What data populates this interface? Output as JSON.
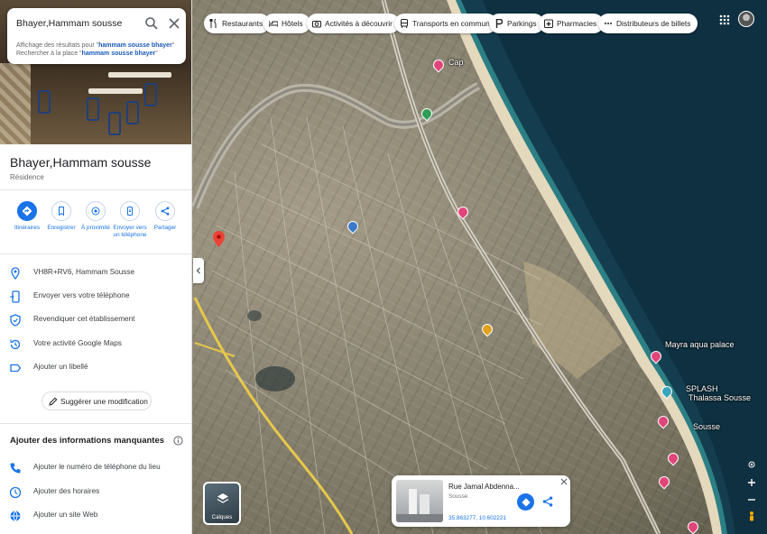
{
  "search": {
    "value": "Bhayer,Hammam sousse",
    "hint_line1_prefix": "Affichage des résultats pour ",
    "hint_line1_bold": "hammam sousse bhayer",
    "hint_line2_prefix": "Rechercher à la place ",
    "hint_line2_bold": "hammam sousse bhayer"
  },
  "place": {
    "title": "Bhayer,Hammam sousse",
    "type": "Résidence"
  },
  "actions": [
    {
      "label": "Itinéraires",
      "icon": "directions-icon"
    },
    {
      "label": "Enregistrer",
      "icon": "bookmark-icon"
    },
    {
      "label": "À proximité",
      "icon": "nearby-icon"
    },
    {
      "label": "Envoyer vers un téléphone",
      "icon": "send-to-phone-icon"
    },
    {
      "label": "Partager",
      "icon": "share-icon"
    }
  ],
  "info_rows": [
    {
      "text": "VH8R+RV6, Hammam Sousse",
      "icon": "location-pin-icon"
    },
    {
      "text": "Envoyer vers votre téléphone",
      "icon": "phone-send-icon"
    },
    {
      "text": "Revendiquer cet établissement",
      "icon": "verified-shield-icon"
    },
    {
      "text": "Votre activité Google Maps",
      "icon": "history-icon"
    },
    {
      "text": "Ajouter un libellé",
      "icon": "label-icon"
    }
  ],
  "suggest_label": "Suggérer une modification",
  "missing": {
    "title": "Ajouter des informations manquantes",
    "rows": [
      {
        "text": "Ajouter le numéro de téléphone du lieu",
        "icon": "phone-icon"
      },
      {
        "text": "Ajouter des horaires",
        "icon": "clock-icon"
      },
      {
        "text": "Ajouter un site Web",
        "icon": "globe-icon"
      }
    ]
  },
  "chips": [
    {
      "label": "Restaurants",
      "icon": "restaurant-icon"
    },
    {
      "label": "Hôtels",
      "icon": "hotel-icon"
    },
    {
      "label": "Activités à découvrir",
      "icon": "camera-icon"
    },
    {
      "label": "Transports en commun",
      "icon": "transit-icon"
    },
    {
      "label": "Parkings",
      "icon": "parking-icon"
    },
    {
      "label": "Pharmacies",
      "icon": "pharmacy-icon"
    },
    {
      "label": "Distributeurs de billets",
      "icon": "atm-icon"
    }
  ],
  "layers_label": "Calques",
  "map_labels": {
    "aqua_palace": "Mayra aqua palace",
    "thalassa": "Thalassa Sousse",
    "splash": "SPLASH",
    "sousse": "Sousse",
    "cap": "Cap"
  },
  "card": {
    "title": "Rue Jamal Abdenna...",
    "city": "Sousse",
    "coords": "35.863277, 10.602221"
  },
  "colors": {
    "accent": "#1a73e8",
    "red_pin": "#ea4335",
    "sea": "#143d4f"
  }
}
